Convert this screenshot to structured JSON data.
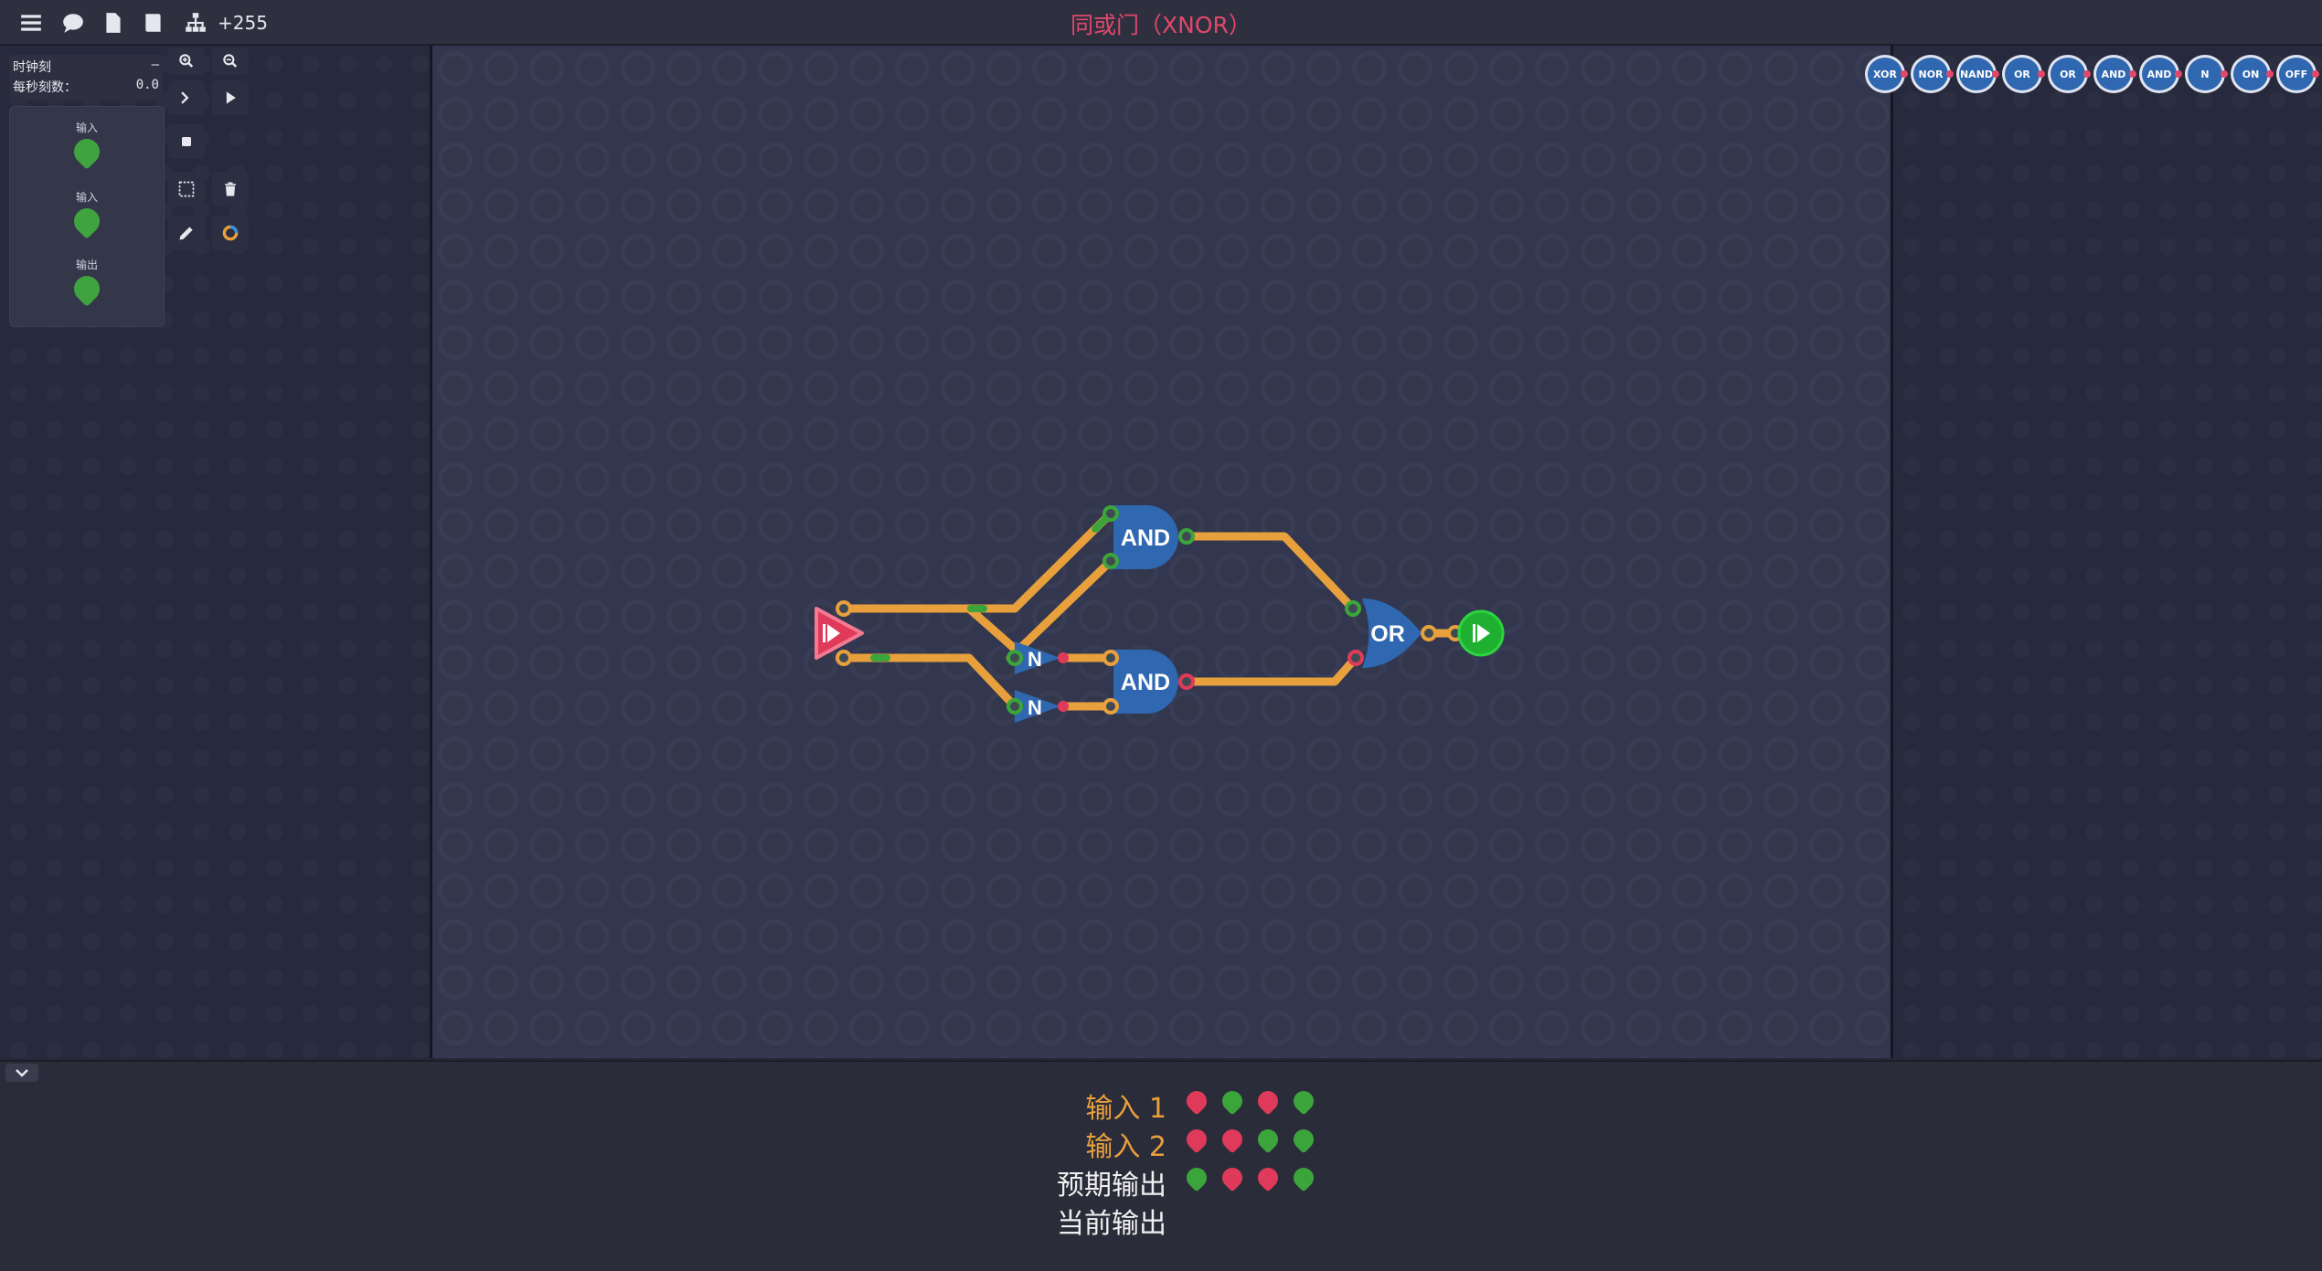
{
  "topbar": {
    "title": "同或门（XNOR）",
    "count": "+255",
    "icons": [
      "menu-icon",
      "chat-icon",
      "file-icon",
      "book-icon",
      "hierarchy-icon"
    ]
  },
  "clock": {
    "tick_label": "时钟刻",
    "tick_value": "–",
    "rate_label": "每秒刻数：",
    "rate_value": "0.0"
  },
  "io_panel": {
    "items": [
      {
        "label": "输入"
      },
      {
        "label": "输入"
      },
      {
        "label": "输出"
      }
    ]
  },
  "palette": [
    "XOR",
    "NOR",
    "NAND",
    "OR",
    "OR",
    "AND",
    "AND",
    "N",
    "ON",
    "OFF"
  ],
  "circuit": {
    "gates": [
      {
        "type": "AND"
      },
      {
        "type": "AND"
      },
      {
        "type": "N"
      },
      {
        "type": "N"
      },
      {
        "type": "OR"
      }
    ]
  },
  "truth_table": {
    "rows": [
      {
        "label": "输入 1",
        "color": "#e8a03c",
        "values": [
          "red",
          "green",
          "red",
          "green"
        ]
      },
      {
        "label": "输入 2",
        "color": "#e8a03c",
        "values": [
          "red",
          "red",
          "green",
          "green"
        ]
      },
      {
        "label": "预期输出",
        "color": "#f0f0f0",
        "values": [
          "green",
          "red",
          "red",
          "green"
        ]
      },
      {
        "label": "当前输出",
        "color": "#f0f0f0",
        "values": []
      }
    ]
  },
  "colors": {
    "wire": "#e8a03c",
    "gate": "#2f68b0",
    "on": "#3ba53b",
    "off": "#e03a5a",
    "title": "#e0486a"
  }
}
